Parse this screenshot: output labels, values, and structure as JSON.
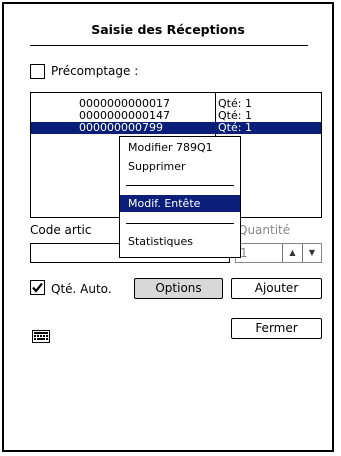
{
  "window": {
    "title": "Saisie des Réceptions"
  },
  "precomptage": {
    "label": "Précomptage :",
    "checked": false
  },
  "list": {
    "rows": [
      {
        "code": "0000000000017",
        "qty": "Qté: 1",
        "selected": false
      },
      {
        "code": "0000000000147",
        "qty": "Qté: 1",
        "selected": false
      },
      {
        "code": "000000000799",
        "qty": "Qté: 1",
        "selected": true
      }
    ]
  },
  "context_menu": {
    "items": [
      {
        "label": "Modifier 789Q1",
        "highlighted": false
      },
      {
        "label": "Supprimer",
        "highlighted": false
      },
      {
        "label": "Modif. Entête",
        "highlighted": true
      },
      {
        "label": "Statistiques",
        "highlighted": false
      }
    ]
  },
  "code_article": {
    "label": "Code artic",
    "value": ""
  },
  "quantite": {
    "label": "Quantité",
    "value": "1"
  },
  "qte_auto": {
    "label": "Qté. Auto.",
    "checked": true
  },
  "buttons": {
    "options": "Options",
    "ajouter": "Ajouter",
    "fermer": "Fermer"
  },
  "icons": {
    "keyboard": "keyboard-icon",
    "checkmark": "checkmark-icon"
  },
  "colors": {
    "selection": "#0a1e7a",
    "button_grey": "#d8d8d8"
  }
}
